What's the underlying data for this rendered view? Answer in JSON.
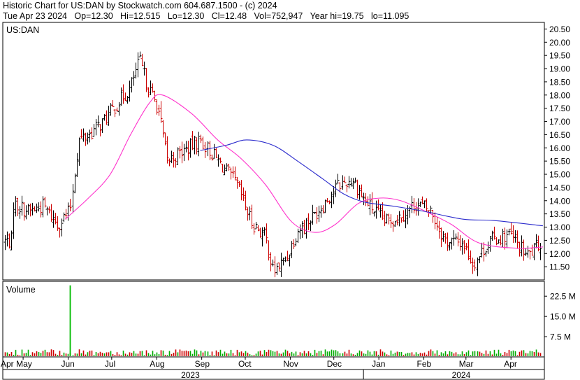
{
  "header": {
    "title_line": "Historic Chart for US:DAN by Stockwatch.com 604.687.1500 - (c) 2024",
    "quote_line": "Tue Apr 23 2024   Op=12.30   Hi=12.515   Lo=12.30   Cl=12.48   Vol=752,947   Year hi=19.75   lo=11.095"
  },
  "colors": {
    "up_bar": "#000000",
    "down_bar": "#cc0000",
    "ma_short": "#ff33cc",
    "ma_long": "#2a2acc",
    "volume_up": "#00aa00",
    "volume_down": "#cc0000",
    "volume_spike": "#00bb00",
    "frame": "#000000",
    "background": "#ffffff"
  },
  "chart_data": [
    {
      "type": "ohlc",
      "title": "US:DAN",
      "y_ticks": [
        "11.50",
        "12.00",
        "12.50",
        "13.00",
        "13.50",
        "14.00",
        "14.50",
        "15.00",
        "15.50",
        "16.00",
        "16.50",
        "17.00",
        "17.50",
        "18.00",
        "18.50",
        "19.00",
        "19.50",
        "20.00",
        "20.50"
      ],
      "ylim": [
        11.0,
        20.75
      ],
      "x_months": [
        "Apr",
        "May",
        "Jun",
        "Jul",
        "Aug",
        "Sep",
        "Oct",
        "Nov",
        "Dec",
        "Jan",
        "Feb",
        "Mar",
        "Apr"
      ],
      "x_years": [
        "2023",
        "2024"
      ],
      "closes": [
        {
          "d": "2023-04-24",
          "c": 13.9
        },
        {
          "d": "2023-05-05",
          "c": 13.6
        },
        {
          "d": "2023-05-15",
          "c": 13.8
        },
        {
          "d": "2023-05-25",
          "c": 13.1
        },
        {
          "d": "2023-06-02",
          "c": 13.6
        },
        {
          "d": "2023-06-08",
          "c": 16.3
        },
        {
          "d": "2023-06-15",
          "c": 16.5
        },
        {
          "d": "2023-06-25",
          "c": 17.0
        },
        {
          "d": "2023-07-05",
          "c": 17.7
        },
        {
          "d": "2023-07-13",
          "c": 18.2
        },
        {
          "d": "2023-07-20",
          "c": 19.3
        },
        {
          "d": "2023-07-26",
          "c": 18.3
        },
        {
          "d": "2023-08-02",
          "c": 17.5
        },
        {
          "d": "2023-08-08",
          "c": 15.5
        },
        {
          "d": "2023-08-20",
          "c": 15.9
        },
        {
          "d": "2023-08-31",
          "c": 16.3
        },
        {
          "d": "2023-09-12",
          "c": 15.5
        },
        {
          "d": "2023-09-25",
          "c": 14.6
        },
        {
          "d": "2023-10-05",
          "c": 13.2
        },
        {
          "d": "2023-10-15",
          "c": 12.6
        },
        {
          "d": "2023-10-20",
          "c": 11.3
        },
        {
          "d": "2023-10-29",
          "c": 11.8
        },
        {
          "d": "2023-11-06",
          "c": 12.9
        },
        {
          "d": "2023-11-15",
          "c": 13.3
        },
        {
          "d": "2023-11-24",
          "c": 13.9
        },
        {
          "d": "2023-12-04",
          "c": 14.6
        },
        {
          "d": "2023-12-14",
          "c": 14.8
        },
        {
          "d": "2023-12-22",
          "c": 14.0
        },
        {
          "d": "2024-01-05",
          "c": 13.2
        },
        {
          "d": "2024-01-15",
          "c": 13.4
        },
        {
          "d": "2024-01-27",
          "c": 13.9
        },
        {
          "d": "2024-02-06",
          "c": 13.6
        },
        {
          "d": "2024-02-15",
          "c": 12.5
        },
        {
          "d": "2024-02-28",
          "c": 12.4
        },
        {
          "d": "2024-03-06",
          "c": 11.6
        },
        {
          "d": "2024-03-17",
          "c": 12.5
        },
        {
          "d": "2024-03-31",
          "c": 12.7
        },
        {
          "d": "2024-04-12",
          "c": 11.9
        },
        {
          "d": "2024-04-23",
          "c": 12.48
        }
      ],
      "ma_short": [
        {
          "d": "2023-05-30",
          "c": 13.3
        },
        {
          "d": "2023-06-15",
          "c": 14.1
        },
        {
          "d": "2023-06-30",
          "c": 15.0
        },
        {
          "d": "2023-07-14",
          "c": 16.5
        },
        {
          "d": "2023-07-27",
          "c": 17.7
        },
        {
          "d": "2023-08-05",
          "c": 18.0
        },
        {
          "d": "2023-08-25",
          "c": 17.3
        },
        {
          "d": "2023-09-12",
          "c": 16.3
        },
        {
          "d": "2023-09-28",
          "c": 15.6
        },
        {
          "d": "2023-10-15",
          "c": 14.6
        },
        {
          "d": "2023-11-02",
          "c": 13.2
        },
        {
          "d": "2023-11-18",
          "c": 12.8
        },
        {
          "d": "2023-12-02",
          "c": 13.1
        },
        {
          "d": "2023-12-18",
          "c": 13.9
        },
        {
          "d": "2024-01-02",
          "c": 14.1
        },
        {
          "d": "2024-01-16",
          "c": 14.0
        },
        {
          "d": "2024-02-02",
          "c": 13.6
        },
        {
          "d": "2024-02-20",
          "c": 13.1
        },
        {
          "d": "2024-03-10",
          "c": 12.4
        },
        {
          "d": "2024-04-05",
          "c": 12.2
        },
        {
          "d": "2024-04-23",
          "c": 12.25
        }
      ],
      "ma_long": [
        {
          "d": "2023-08-31",
          "c": 15.9
        },
        {
          "d": "2023-09-18",
          "c": 16.1
        },
        {
          "d": "2023-10-02",
          "c": 16.3
        },
        {
          "d": "2023-10-20",
          "c": 16.1
        },
        {
          "d": "2023-11-06",
          "c": 15.5
        },
        {
          "d": "2023-11-24",
          "c": 14.8
        },
        {
          "d": "2023-12-08",
          "c": 14.25
        },
        {
          "d": "2023-12-22",
          "c": 13.95
        },
        {
          "d": "2024-01-10",
          "c": 13.8
        },
        {
          "d": "2024-02-01",
          "c": 13.6
        },
        {
          "d": "2024-02-28",
          "c": 13.3
        },
        {
          "d": "2024-03-20",
          "c": 13.25
        },
        {
          "d": "2024-04-23",
          "c": 13.05
        }
      ]
    },
    {
      "type": "bar",
      "title": "Volume",
      "y_ticks": [
        "7.5 M",
        "15.0 M",
        "22.5 M"
      ],
      "ylim": [
        0,
        28
      ],
      "unit": "M",
      "spike": {
        "d": "2023-06-02",
        "v": 26.5
      },
      "typical_volume_range": [
        0.6,
        2.8
      ]
    }
  ]
}
